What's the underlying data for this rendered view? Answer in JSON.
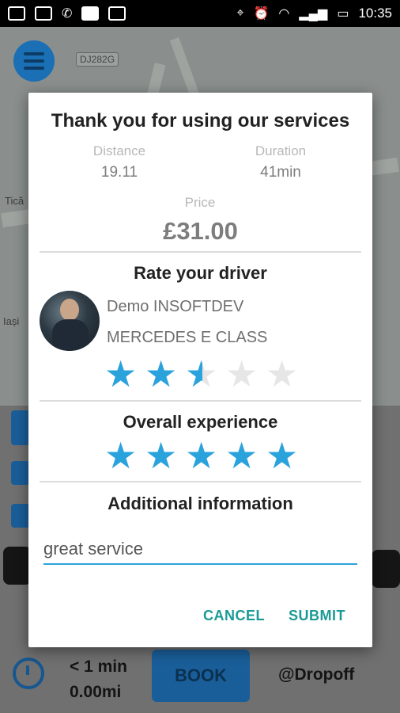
{
  "status_bar": {
    "time": "10:35",
    "left_icons": [
      "gmail-icon",
      "nfc-icon",
      "missed-call-icon",
      "square-icon",
      "image-icon"
    ],
    "right_icons": [
      "location-icon",
      "alarm-icon",
      "wifi-icon",
      "signal-icon",
      "battery-icon"
    ]
  },
  "map": {
    "road_tag": "DJ282G",
    "label_a": "Tică",
    "label_b": "Iași"
  },
  "dialog": {
    "title": "Thank you for using our services",
    "distance_label": "Distance",
    "distance_value": "19.11",
    "duration_label": "Duration",
    "duration_value": "41min",
    "price_label": "Price",
    "price_value": "£31.00",
    "rate_title": "Rate your driver",
    "driver_name": "Demo INSOFTDEV",
    "car_model": "MERCEDES E CLASS",
    "driver_rating": 2.5,
    "overall_title": "Overall experience",
    "overall_rating": 5,
    "info_title": "Additional information",
    "info_value": "great service",
    "cancel_label": "CANCEL",
    "submit_label": "SUBMIT",
    "star_color": "#2aa3dd",
    "action_color": "#1a9a96"
  },
  "bottom_bar": {
    "eta_time": "< 1 min",
    "eta_distance": "0.00mi",
    "book_label": "BOOK",
    "dropoff_label": "@Dropoff"
  }
}
